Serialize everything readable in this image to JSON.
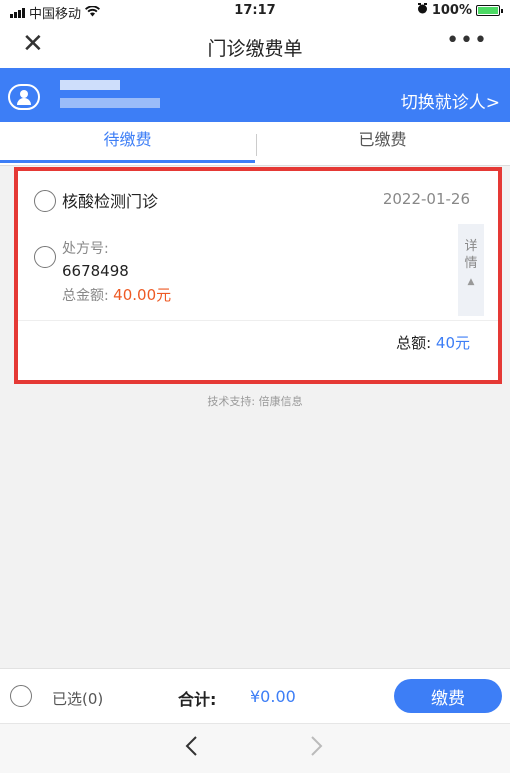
{
  "status_bar": {
    "carrier": "中国移动",
    "wifi_icon": "wifi-icon",
    "time": "17:17",
    "alarm_icon": "alarm-icon",
    "battery": "100%",
    "battery_icon": "battery-charging-icon"
  },
  "nav": {
    "close_icon": "close-icon",
    "title": "门诊缴费单",
    "more_icon": "more-icon"
  },
  "patient": {
    "avatar_icon": "user-avatar-icon",
    "switch_label": "切换就诊人>"
  },
  "tabs": [
    {
      "label": "待缴费",
      "active": true
    },
    {
      "label": "已缴费",
      "active": false
    }
  ],
  "card": {
    "clinic_name": "核酸检测门诊",
    "date": "2022-01-26",
    "prescription_label": "处方号:",
    "prescription_number": "6678498",
    "amount_label": "总金额:",
    "amount_value": "40.00元",
    "detail_label_top": "详",
    "detail_label_bottom": "情",
    "total_label": "总额:",
    "total_value": "40元"
  },
  "footer": {
    "support_text": "技术支持: 倍康信息"
  },
  "bottom_bar": {
    "selected_label": "已选(0)",
    "sum_label": "合计:",
    "sum_value": "¥0.00",
    "pay_label": "缴费"
  },
  "browser": {
    "back_icon": "chevron-left-icon",
    "forward_icon": "chevron-right-icon"
  },
  "colors": {
    "brand": "#3d7ef6",
    "amount": "#ee5a24",
    "highlight_border": "#e53935"
  }
}
